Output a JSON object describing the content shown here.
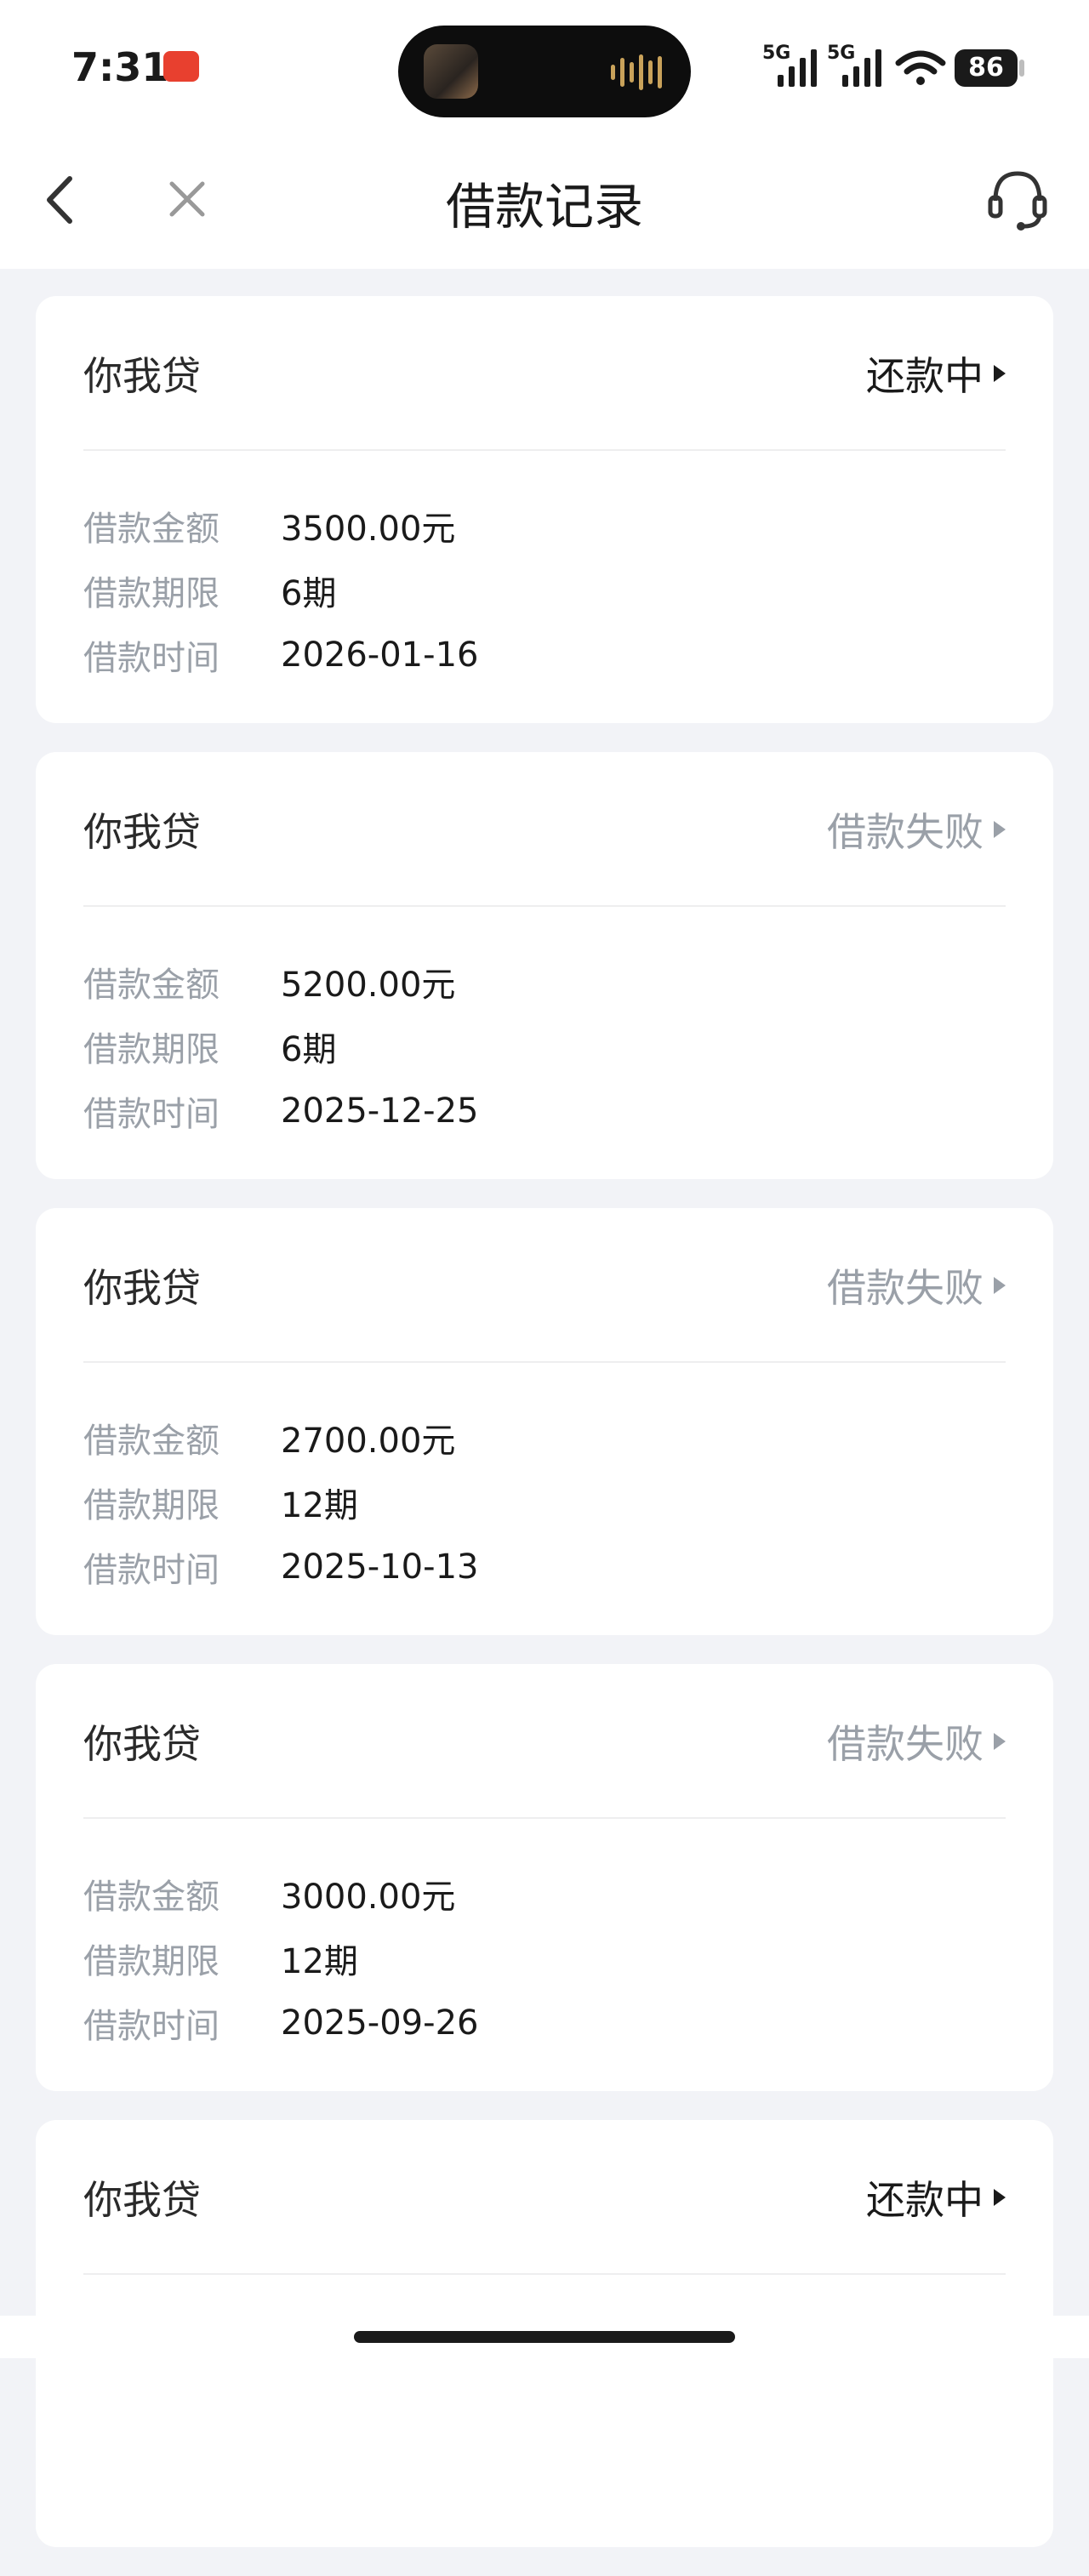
{
  "status_bar": {
    "time": "7:31",
    "signal_1_label": "5G",
    "signal_2_label": "5G",
    "battery": "86",
    "icons": [
      "app-notification-icon",
      "signal-icon",
      "signal-icon",
      "wifi-icon",
      "battery-icon"
    ]
  },
  "nav": {
    "title": "借款记录",
    "back_icon": "chevron-left-icon",
    "close_icon": "close-icon",
    "support_icon": "customer-service-headset-icon"
  },
  "labels": {
    "amount": "借款金额",
    "term": "借款期限",
    "date": "借款时间"
  },
  "colors": {
    "status_active": "#1a1a1a",
    "status_failed": "#9aa0a8",
    "background": "#f2f3f7"
  },
  "records": [
    {
      "name": "你我贷",
      "status": "还款中",
      "status_type": "active",
      "amount": "3500.00元",
      "term": "6期",
      "date": "2026-01-16"
    },
    {
      "name": "你我贷",
      "status": "借款失败",
      "status_type": "failed",
      "amount": "5200.00元",
      "term": "6期",
      "date": "2025-12-25"
    },
    {
      "name": "你我贷",
      "status": "借款失败",
      "status_type": "failed",
      "amount": "2700.00元",
      "term": "12期",
      "date": "2025-10-13"
    },
    {
      "name": "你我贷",
      "status": "借款失败",
      "status_type": "failed",
      "amount": "3000.00元",
      "term": "12期",
      "date": "2025-09-26"
    },
    {
      "name": "你我贷",
      "status": "还款中",
      "status_type": "active"
    }
  ]
}
